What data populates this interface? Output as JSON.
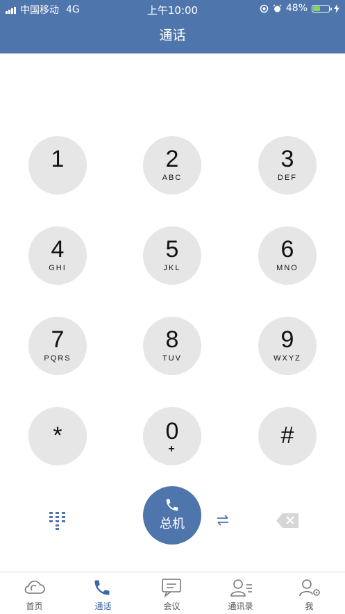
{
  "status_bar": {
    "carrier": "中国移动",
    "network": "4G",
    "time": "上午10:00",
    "battery_percent": "48%",
    "battery_level": 0.48
  },
  "nav": {
    "title": "通话"
  },
  "keypad": [
    {
      "digit": "1",
      "letters": ""
    },
    {
      "digit": "2",
      "letters": "ABC"
    },
    {
      "digit": "3",
      "letters": "DEF"
    },
    {
      "digit": "4",
      "letters": "GHI"
    },
    {
      "digit": "5",
      "letters": "JKL"
    },
    {
      "digit": "6",
      "letters": "MNO"
    },
    {
      "digit": "7",
      "letters": "PQRS"
    },
    {
      "digit": "8",
      "letters": "TUV"
    },
    {
      "digit": "9",
      "letters": "WXYZ"
    },
    {
      "digit": "*",
      "letters": ""
    },
    {
      "digit": "0",
      "letters": "+"
    },
    {
      "digit": "#",
      "letters": ""
    }
  ],
  "call_button": {
    "label": "总机",
    "icon": "phone-icon"
  },
  "icons": {
    "keypad_toggle": "keypad-icon",
    "switch": "swap-arrows-icon",
    "delete": "backspace-icon"
  },
  "tabs": [
    {
      "label": "首页",
      "icon": "cloud-icon",
      "active": false
    },
    {
      "label": "通话",
      "icon": "phone-icon",
      "active": true
    },
    {
      "label": "会议",
      "icon": "chat-icon",
      "active": false
    },
    {
      "label": "通讯录",
      "icon": "contacts-icon",
      "active": false
    },
    {
      "label": "我",
      "icon": "user-settings-icon",
      "active": false
    }
  ],
  "colors": {
    "primary": "#4f75ad",
    "key_bg": "#e6e6e6",
    "tab_active": "#3f67a6"
  }
}
